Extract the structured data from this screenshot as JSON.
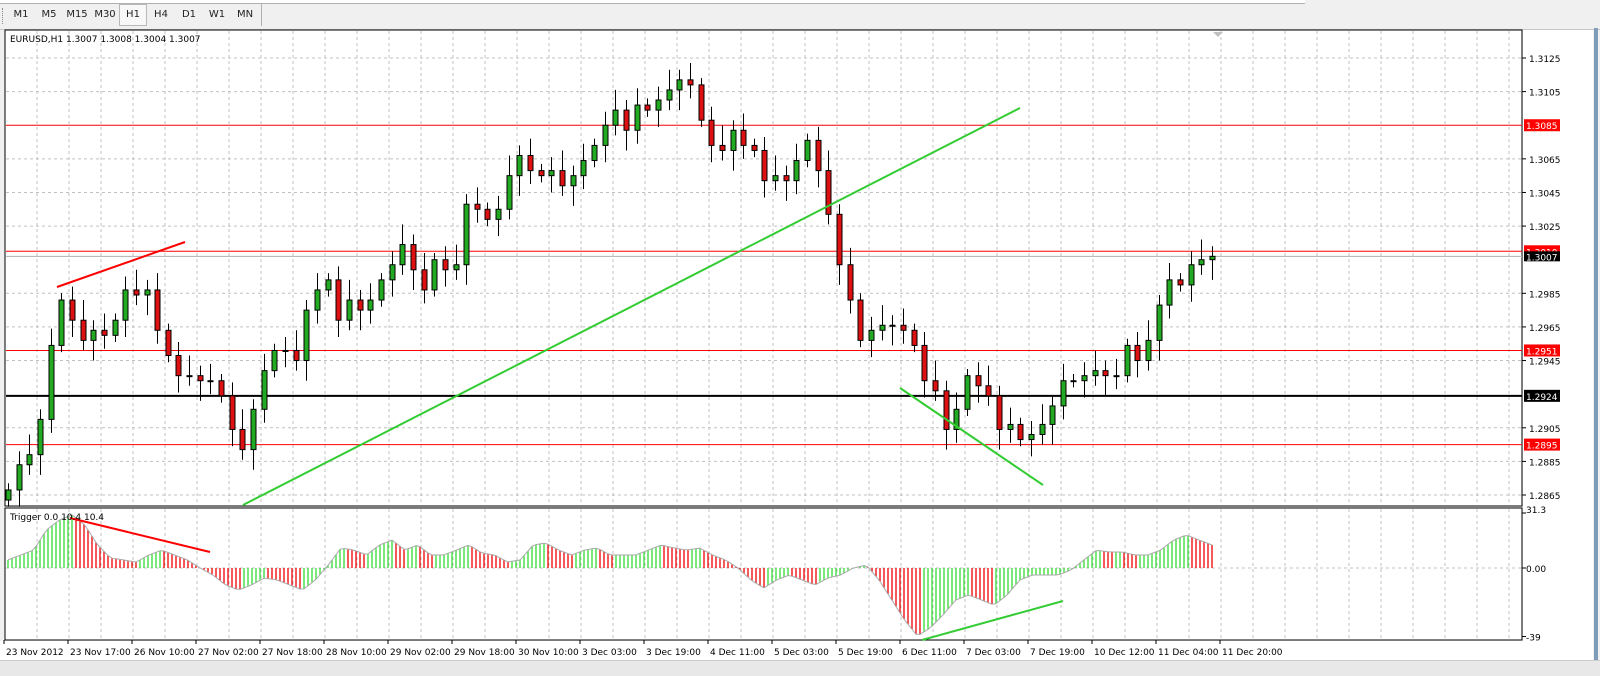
{
  "toolbar": {
    "timeframes": [
      "M1",
      "M5",
      "M15",
      "M30",
      "H1",
      "H4",
      "D1",
      "W1",
      "MN"
    ],
    "active": "H1"
  },
  "chart": {
    "header": "EURUSD,H1  1.3007 1.3008 1.3004 1.3007",
    "symbol": "EURUSD",
    "timeframe": "H1",
    "ohlc": {
      "open": 1.3007,
      "high": 1.3008,
      "low": 1.3004,
      "close": 1.3007
    }
  },
  "colors": {
    "bull_body": "#22aa22",
    "bear_body": "#dd1111",
    "level_red": "#ff0000",
    "level_black": "#000000",
    "trend_green": "#33cc33",
    "trend_red": "#ff0000",
    "osc_up": "#33dd33",
    "osc_down": "#ee0000"
  },
  "chart_data": [
    {
      "type": "candlestick",
      "title": "EURUSD,H1",
      "ylim": [
        1.2858,
        1.3135
      ],
      "price_ticks": [
        "1.3125",
        "1.3105",
        "1.3065",
        "1.3045",
        "1.3025",
        "1.2985",
        "1.2965",
        "1.2945",
        "1.2905",
        "1.2885",
        "1.2865"
      ],
      "x_ticks": [
        "23 Nov 2012",
        "23 Nov 17:00",
        "26 Nov 10:00",
        "27 Nov 02:00",
        "27 Nov 18:00",
        "28 Nov 10:00",
        "29 Nov 02:00",
        "29 Nov 18:00",
        "30 Nov 10:00",
        "3 Dec 03:00",
        "3 Dec 19:00",
        "4 Dec 11:00",
        "5 Dec 03:00",
        "5 Dec 19:00",
        "6 Dec 11:00",
        "7 Dec 03:00",
        "7 Dec 19:00",
        "10 Dec 12:00",
        "11 Dec 04:00",
        "11 Dec 20:00"
      ],
      "current_price": "1.3007",
      "levels": [
        {
          "price": 1.3085,
          "label": "1.3085",
          "color": "#ff0000"
        },
        {
          "price": 1.301,
          "label": "1.3010",
          "color": "#ff0000"
        },
        {
          "price": 1.2951,
          "label": "1.2951",
          "color": "#ff0000"
        },
        {
          "price": 1.2924,
          "label": "1.2924",
          "color": "#000000"
        },
        {
          "price": 1.2895,
          "label": "1.2895",
          "color": "#ff0000"
        }
      ],
      "closes": [
        1.2868,
        1.2883,
        1.2889,
        1.291,
        1.2954,
        1.2981,
        1.2969,
        1.2957,
        1.2963,
        1.296,
        1.2969,
        1.2987,
        1.2984,
        1.2987,
        1.2963,
        1.2948,
        1.2936,
        1.2936,
        1.2933,
        1.2933,
        1.2924,
        1.2904,
        1.2892,
        1.2916,
        1.2939,
        1.2951,
        1.2951,
        1.2945,
        1.2975,
        1.2987,
        1.2993,
        1.2969,
        1.2981,
        1.2975,
        1.2981,
        1.2993,
        1.3002,
        1.3014,
        1.2999,
        1.2987,
        1.3005,
        1.2999,
        1.3002,
        1.3038,
        1.3035,
        1.3029,
        1.3035,
        1.3055,
        1.3067,
        1.3058,
        1.3055,
        1.3058,
        1.3049,
        1.3055,
        1.3064,
        1.3073,
        1.3085,
        1.3094,
        1.3082,
        1.3097,
        1.3094,
        1.31,
        1.3106,
        1.3112,
        1.3109,
        1.3088,
        1.3073,
        1.307,
        1.3082,
        1.3073,
        1.307,
        1.3052,
        1.3055,
        1.3052,
        1.3064,
        1.3076,
        1.3058,
        1.3032,
        1.3002,
        1.2981,
        1.2957,
        1.2963,
        1.2966,
        1.2966,
        1.2963,
        1.2954,
        1.2933,
        1.2927,
        1.2904,
        1.2916,
        1.2936,
        1.293,
        1.2924,
        1.2904,
        1.2907,
        1.2898,
        1.2901,
        1.2907,
        1.2918,
        1.2933,
        1.2933,
        1.2936,
        1.2939,
        1.2936,
        1.2936,
        1.2954,
        1.2945,
        1.2957,
        1.2978,
        1.2993,
        1.299,
        1.3002,
        1.3005,
        1.3007
      ]
    },
    {
      "type": "bar",
      "title": "Trigger 0.0 10.4 10.4",
      "ylim": [
        -39,
        31.3
      ],
      "y_ticks": [
        "31.3",
        "0.00",
        "-39"
      ],
      "values": [
        4.6,
        7.4,
        10.2,
        21.6,
        27.3,
        30.2,
        24.5,
        13.1,
        5.7,
        4.6,
        3.4,
        7.4,
        10.2,
        7.4,
        4.6,
        0,
        -4,
        -9.7,
        -12.5,
        -9.7,
        -5.7,
        -6.8,
        -9.7,
        -12.5,
        -6.8,
        1.7,
        11.4,
        10.2,
        7.4,
        13.1,
        15.9,
        10.2,
        13.1,
        7.4,
        7.4,
        10.2,
        13.1,
        8.5,
        7.4,
        3.4,
        4.6,
        13.1,
        14.2,
        10.2,
        7.4,
        10.2,
        11.4,
        7.4,
        7.4,
        7.4,
        10.2,
        13.1,
        11.4,
        10.2,
        11.4,
        7.4,
        4.6,
        0,
        -6.8,
        -11.4,
        -6.8,
        -4,
        -6.8,
        -9.7,
        -5.7,
        -4,
        0,
        1.7,
        -6.8,
        -18.2,
        -29.6,
        -38.7,
        -34.1,
        -26.7,
        -18.2,
        -15.4,
        -18.2,
        -21.1,
        -15.4,
        -6.8,
        -4,
        -4,
        -4,
        -1.1,
        4.6,
        10.2,
        9.1,
        9.1,
        7.4,
        7.4,
        10.2,
        15.9,
        18.8,
        15.9,
        13.1
      ]
    }
  ]
}
